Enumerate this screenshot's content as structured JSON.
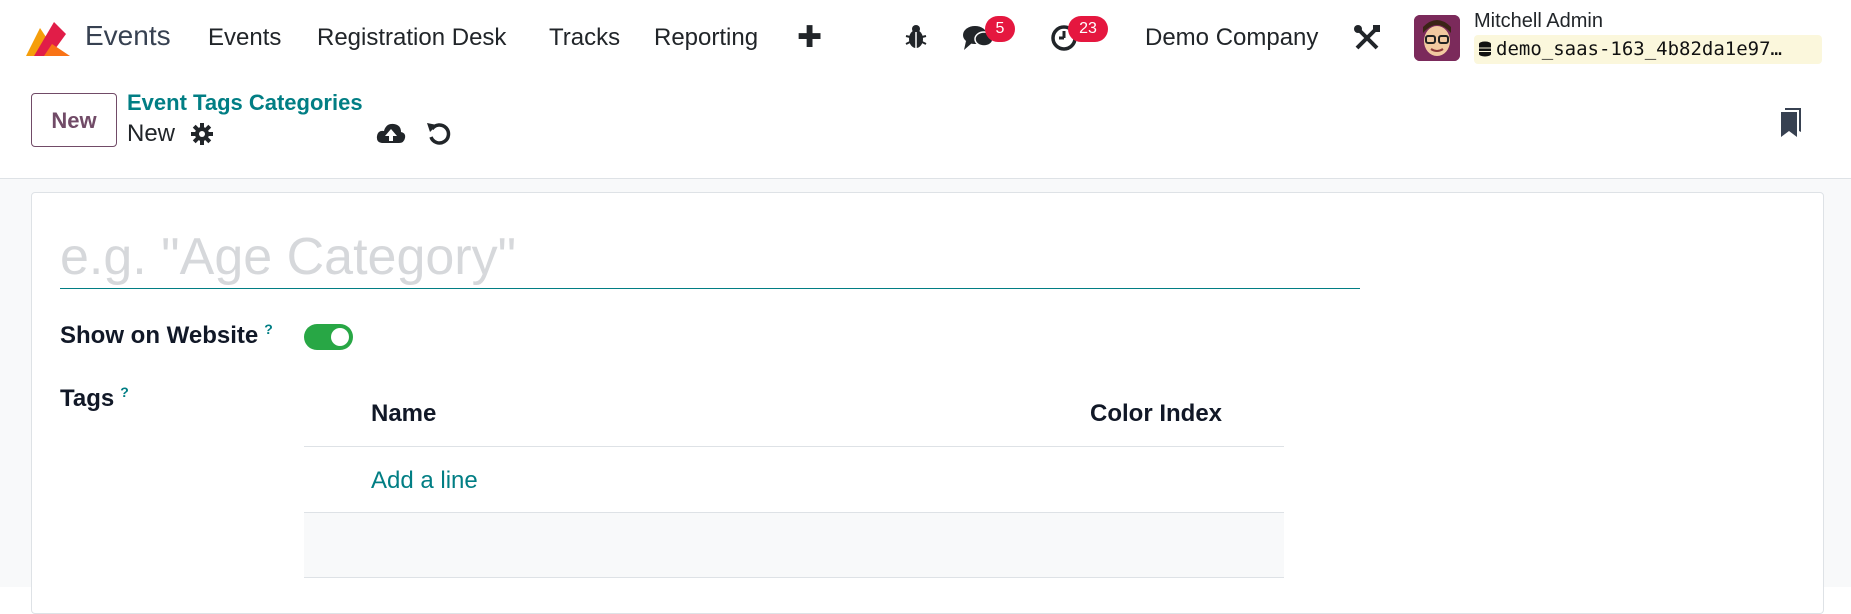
{
  "navbar": {
    "app_name": "Events",
    "menu": [
      "Events",
      "Registration Desk",
      "Tracks",
      "Reporting"
    ],
    "messages_count": "5",
    "activities_count": "23",
    "company": "Demo Company",
    "user_name": "Mitchell Admin",
    "database": "demo_saas-163_4b82da1e97…",
    "icons": [
      "app-logo-icon",
      "plus-icon",
      "bug-icon",
      "chat-icon",
      "clock-icon",
      "tools-icon",
      "database-icon"
    ]
  },
  "control_panel": {
    "new_label": "New",
    "breadcrumb": "Event Tags Categories",
    "record_name": "New"
  },
  "form": {
    "name_placeholder": "e.g. \"Age Category\"",
    "show_on_website_label": "Show on Website",
    "help_mark": "?",
    "show_on_website": true,
    "tags_label": "Tags",
    "tags_columns": [
      "Name",
      "Color Index"
    ],
    "add_line": "Add a line"
  },
  "colors": {
    "accent": "#017e84",
    "primary": "#714b67",
    "badge": "#e5173f",
    "toggle_on": "#28a745"
  }
}
